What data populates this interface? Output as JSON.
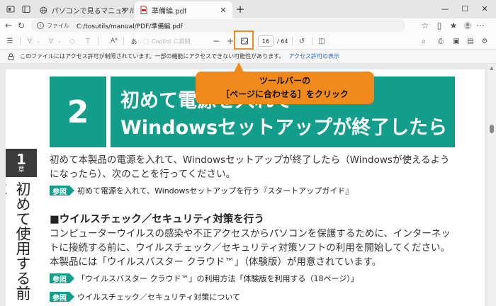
{
  "browser": {
    "tabs": [
      {
        "title": "パソコンで見るマニュアル",
        "active": false
      },
      {
        "title": "準備編.pdf",
        "active": true
      }
    ],
    "new_tab": "+",
    "window_controls": {
      "minimize": "—",
      "maximize": "☐",
      "close": "✕"
    }
  },
  "address_bar": {
    "scheme_label": "ファイル",
    "url": "C:/tosutils/manual/PDF/準備編.pdf"
  },
  "pdf_toolbar": {
    "read_aloud": "Aᴬ",
    "translate": "あ",
    "copilot_label": "Copilot に質問",
    "zoom_out": "−",
    "zoom_in": "+",
    "page_current": "16",
    "page_total": "/ 64"
  },
  "notice": {
    "message": "このファイルにはアクセス許可が制限されています。一部の機能にアクセスできない可能性があります。",
    "link": "アクセス許可の表示"
  },
  "callout": {
    "line1": "ツールバーの",
    "line2": "［ページに合わせる］をクリック"
  },
  "document": {
    "chapter_number": "2",
    "chapter_title_line1": "初めて電源を入れて",
    "chapter_title_line2": "Windowsセットアップが終了したら",
    "side_tab_number": "1",
    "side_tab_label": "章",
    "side_vertical_text": "初めて使用する前に",
    "intro_line1": "初めて本製品の電源を入れて、Windowsセットアップが終了したら（Windowsが使えるよう",
    "intro_line2": "になったら）、次のことを行ってください。",
    "ref1_badge": "参照",
    "ref1_text": "初めて電源を入れて、Windowsセットアップを行う『スタートアップガイド』",
    "section_heading": "■ウイルスチェック／セキュリティ対策を行う",
    "para_line1": "コンピューターウイルスの感染や不正アクセスからパソコンを保護するために、インターネッ",
    "para_line2": "トに接続する前に、ウイルスチェック／セキュリティ対策ソフトの利用を開始してください。",
    "para_line3": "本製品には「ウイルスバスター クラウド™」（体験版）が用意されています。",
    "ref2_badge": "参照",
    "ref2_text": "「ウイルスバスター クラウド™」の利用方法「体験版を利用する（18ページ）」",
    "ref3_badge": "参照",
    "ref3_text": "ウイルスチェック／セキュリティ対策について"
  },
  "colors": {
    "accent_green": "#129e8b",
    "callout_orange": "#f08a1c",
    "link_blue": "#2566c4"
  }
}
